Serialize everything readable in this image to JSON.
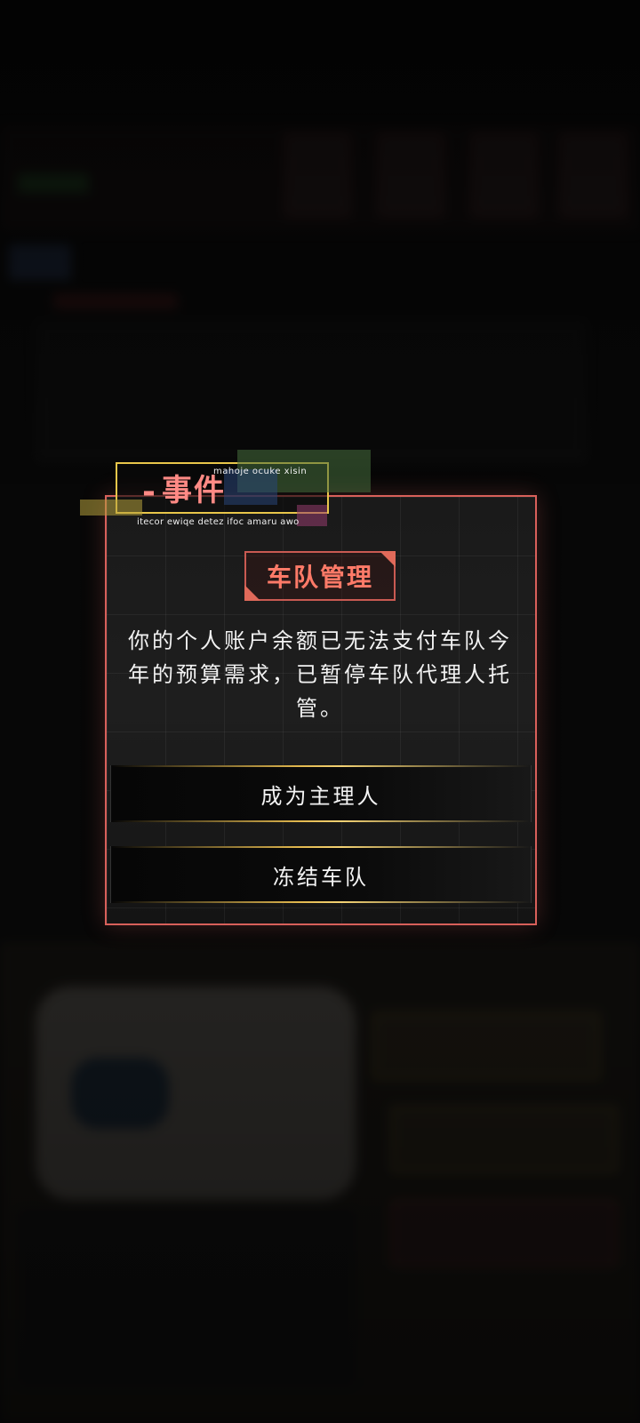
{
  "event_tag": {
    "dash": "-",
    "title": "事件",
    "sub_top": "mahoje ocuke xisin",
    "sub_bottom": "itecor ewiqe detez ifoc amaru awo"
  },
  "dialog": {
    "heading": "车队管理",
    "message": "你的个人账户余额已无法支付车队今年的预算需求，已暂停车队代理人托管。",
    "buttons": [
      {
        "label": "成为主理人"
      },
      {
        "label": "冻结车队"
      }
    ]
  },
  "colors": {
    "dialog_border": "#d8605a",
    "heading_text": "#ff7a68",
    "event_title": "#ff8a85",
    "event_tag_border": "#e8c64a",
    "button_line": "#e2b84e"
  }
}
